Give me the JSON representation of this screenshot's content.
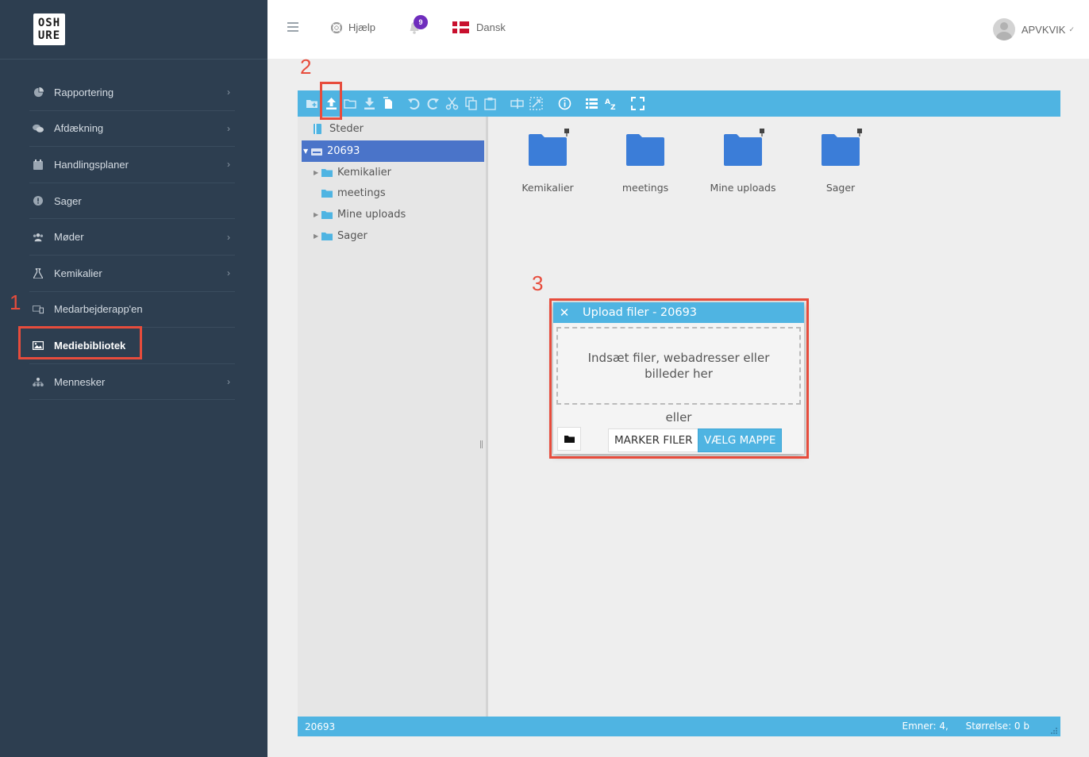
{
  "logo": {
    "line1": "OSH",
    "line2": "URE"
  },
  "sidebar": {
    "items": [
      {
        "label": "Rapportering",
        "icon": "pie-chart-icon",
        "has_chevron": true
      },
      {
        "label": "Afdækning",
        "icon": "chat-bubbles-icon",
        "has_chevron": true
      },
      {
        "label": "Handlingsplaner",
        "icon": "calendar-icon",
        "has_chevron": true
      },
      {
        "label": "Sager",
        "icon": "exclamation-circle-icon",
        "has_chevron": false
      },
      {
        "label": "Møder",
        "icon": "users-icon",
        "has_chevron": true
      },
      {
        "label": "Kemikalier",
        "icon": "flask-icon",
        "has_chevron": true
      },
      {
        "label": "Medarbejderapp'en",
        "icon": "devices-icon",
        "has_chevron": false
      },
      {
        "label": "Mediebibliotek",
        "icon": "image-icon",
        "has_chevron": false,
        "active": true
      },
      {
        "label": "Mennesker",
        "icon": "sitemap-icon",
        "has_chevron": true
      }
    ]
  },
  "annotations": {
    "one": "1",
    "two": "2",
    "three": "3"
  },
  "topbar": {
    "help_label": "Hjælp",
    "notification_count": "9",
    "language_label": "Dansk",
    "user_name": "APVKVIK"
  },
  "tree": {
    "root": "Steder",
    "selected": "20693",
    "children": [
      "Kemikalier",
      "meetings",
      "Mine uploads",
      "Sager"
    ]
  },
  "files": [
    {
      "name": "Kemikalier",
      "pinned": true
    },
    {
      "name": "meetings",
      "pinned": false
    },
    {
      "name": "Mine uploads",
      "pinned": true
    },
    {
      "name": "Sager",
      "pinned": true
    }
  ],
  "statusbar": {
    "path": "20693",
    "items": "Emner: 4,",
    "size": "Størrelse: 0 b"
  },
  "dialog": {
    "title": "Upload filer - 20693",
    "dropzone_text": "Indsæt filer, webadresser eller billeder her",
    "or_text": "eller",
    "select_files_label": "MARKER FILER",
    "select_folder_label": "VÆLG MAPPE"
  },
  "colors": {
    "sidebar_bg": "#2d3e50",
    "accent": "#4fb4e2",
    "selected_row": "#4a74c9",
    "folder": "#3b7dd8",
    "annotation": "#e74c3c",
    "badge": "#6f2dbd"
  }
}
